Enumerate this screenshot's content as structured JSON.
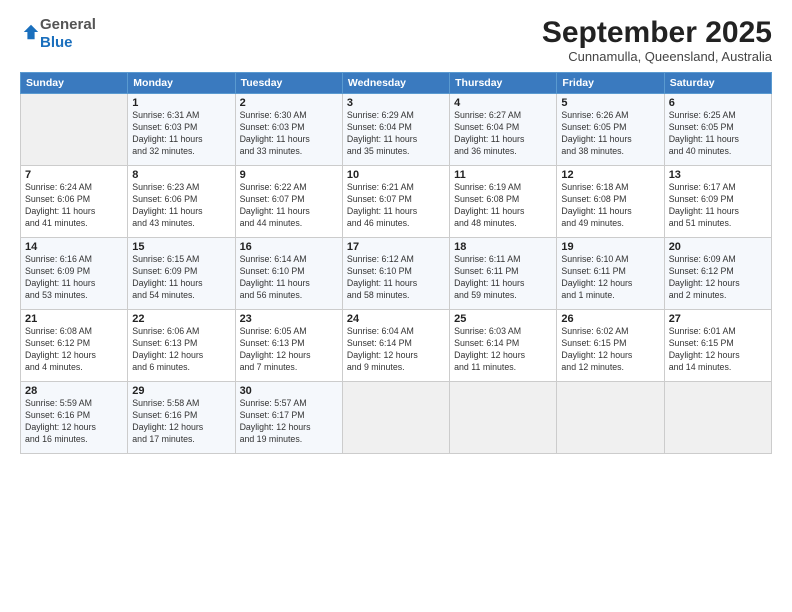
{
  "logo": {
    "general": "General",
    "blue": "Blue"
  },
  "header": {
    "title": "September 2025",
    "location": "Cunnamulla, Queensland, Australia"
  },
  "days_of_week": [
    "Sunday",
    "Monday",
    "Tuesday",
    "Wednesday",
    "Thursday",
    "Friday",
    "Saturday"
  ],
  "weeks": [
    [
      {
        "day": "",
        "info": ""
      },
      {
        "day": "1",
        "info": "Sunrise: 6:31 AM\nSunset: 6:03 PM\nDaylight: 11 hours\nand 32 minutes."
      },
      {
        "day": "2",
        "info": "Sunrise: 6:30 AM\nSunset: 6:03 PM\nDaylight: 11 hours\nand 33 minutes."
      },
      {
        "day": "3",
        "info": "Sunrise: 6:29 AM\nSunset: 6:04 PM\nDaylight: 11 hours\nand 35 minutes."
      },
      {
        "day": "4",
        "info": "Sunrise: 6:27 AM\nSunset: 6:04 PM\nDaylight: 11 hours\nand 36 minutes."
      },
      {
        "day": "5",
        "info": "Sunrise: 6:26 AM\nSunset: 6:05 PM\nDaylight: 11 hours\nand 38 minutes."
      },
      {
        "day": "6",
        "info": "Sunrise: 6:25 AM\nSunset: 6:05 PM\nDaylight: 11 hours\nand 40 minutes."
      }
    ],
    [
      {
        "day": "7",
        "info": "Sunrise: 6:24 AM\nSunset: 6:06 PM\nDaylight: 11 hours\nand 41 minutes."
      },
      {
        "day": "8",
        "info": "Sunrise: 6:23 AM\nSunset: 6:06 PM\nDaylight: 11 hours\nand 43 minutes."
      },
      {
        "day": "9",
        "info": "Sunrise: 6:22 AM\nSunset: 6:07 PM\nDaylight: 11 hours\nand 44 minutes."
      },
      {
        "day": "10",
        "info": "Sunrise: 6:21 AM\nSunset: 6:07 PM\nDaylight: 11 hours\nand 46 minutes."
      },
      {
        "day": "11",
        "info": "Sunrise: 6:19 AM\nSunset: 6:08 PM\nDaylight: 11 hours\nand 48 minutes."
      },
      {
        "day": "12",
        "info": "Sunrise: 6:18 AM\nSunset: 6:08 PM\nDaylight: 11 hours\nand 49 minutes."
      },
      {
        "day": "13",
        "info": "Sunrise: 6:17 AM\nSunset: 6:09 PM\nDaylight: 11 hours\nand 51 minutes."
      }
    ],
    [
      {
        "day": "14",
        "info": "Sunrise: 6:16 AM\nSunset: 6:09 PM\nDaylight: 11 hours\nand 53 minutes."
      },
      {
        "day": "15",
        "info": "Sunrise: 6:15 AM\nSunset: 6:09 PM\nDaylight: 11 hours\nand 54 minutes."
      },
      {
        "day": "16",
        "info": "Sunrise: 6:14 AM\nSunset: 6:10 PM\nDaylight: 11 hours\nand 56 minutes."
      },
      {
        "day": "17",
        "info": "Sunrise: 6:12 AM\nSunset: 6:10 PM\nDaylight: 11 hours\nand 58 minutes."
      },
      {
        "day": "18",
        "info": "Sunrise: 6:11 AM\nSunset: 6:11 PM\nDaylight: 11 hours\nand 59 minutes."
      },
      {
        "day": "19",
        "info": "Sunrise: 6:10 AM\nSunset: 6:11 PM\nDaylight: 12 hours\nand 1 minute."
      },
      {
        "day": "20",
        "info": "Sunrise: 6:09 AM\nSunset: 6:12 PM\nDaylight: 12 hours\nand 2 minutes."
      }
    ],
    [
      {
        "day": "21",
        "info": "Sunrise: 6:08 AM\nSunset: 6:12 PM\nDaylight: 12 hours\nand 4 minutes."
      },
      {
        "day": "22",
        "info": "Sunrise: 6:06 AM\nSunset: 6:13 PM\nDaylight: 12 hours\nand 6 minutes."
      },
      {
        "day": "23",
        "info": "Sunrise: 6:05 AM\nSunset: 6:13 PM\nDaylight: 12 hours\nand 7 minutes."
      },
      {
        "day": "24",
        "info": "Sunrise: 6:04 AM\nSunset: 6:14 PM\nDaylight: 12 hours\nand 9 minutes."
      },
      {
        "day": "25",
        "info": "Sunrise: 6:03 AM\nSunset: 6:14 PM\nDaylight: 12 hours\nand 11 minutes."
      },
      {
        "day": "26",
        "info": "Sunrise: 6:02 AM\nSunset: 6:15 PM\nDaylight: 12 hours\nand 12 minutes."
      },
      {
        "day": "27",
        "info": "Sunrise: 6:01 AM\nSunset: 6:15 PM\nDaylight: 12 hours\nand 14 minutes."
      }
    ],
    [
      {
        "day": "28",
        "info": "Sunrise: 5:59 AM\nSunset: 6:16 PM\nDaylight: 12 hours\nand 16 minutes."
      },
      {
        "day": "29",
        "info": "Sunrise: 5:58 AM\nSunset: 6:16 PM\nDaylight: 12 hours\nand 17 minutes."
      },
      {
        "day": "30",
        "info": "Sunrise: 5:57 AM\nSunset: 6:17 PM\nDaylight: 12 hours\nand 19 minutes."
      },
      {
        "day": "",
        "info": ""
      },
      {
        "day": "",
        "info": ""
      },
      {
        "day": "",
        "info": ""
      },
      {
        "day": "",
        "info": ""
      }
    ]
  ]
}
